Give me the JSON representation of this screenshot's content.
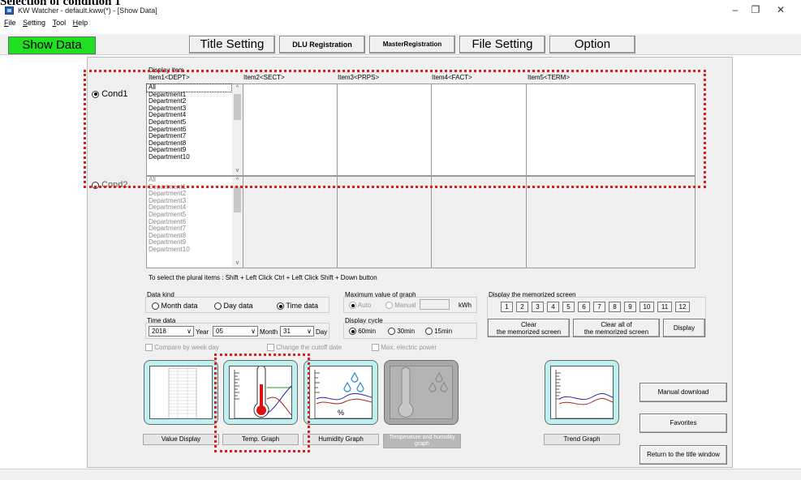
{
  "page_heading": "Selection of condition 1",
  "window": {
    "title": "KW Watcher - default.kww(*) - [Show Data]",
    "controls": [
      "–",
      "❐",
      "✕"
    ]
  },
  "menu": [
    "File",
    "Setting",
    "Tool",
    "Help"
  ],
  "top_tabs": {
    "show_data": "Show Data",
    "title_setting": "Title Setting",
    "dlu_registration": "DLU Registration",
    "master_registration": "MasterRegistration",
    "file_setting": "File Setting",
    "option": "Option"
  },
  "display_item_label": "Display item",
  "columns": [
    "Item1<DEPT>",
    "Item2<SECT>",
    "Item3<PRPS>",
    "Item4<FACT>",
    "Item5<TERM>"
  ],
  "cond1": {
    "label": "Cond1",
    "selected": true,
    "items": [
      "All",
      "Department1",
      "Department2",
      "Department3",
      "Department4",
      "Department5",
      "Department6",
      "Department7",
      "Department8",
      "Department9",
      "Department10"
    ]
  },
  "cond2": {
    "label": "Cond2",
    "selected": false,
    "items": [
      "All",
      "Department1",
      "Department2",
      "Department3",
      "Department4",
      "Department5",
      "Department6",
      "Department7",
      "Department8",
      "Department9",
      "Department10"
    ]
  },
  "hint": "To select the plural items : Shift + Left Click  Ctrl + Left Click  Shift + Down button",
  "data_kind": {
    "label": "Data kind",
    "options": [
      "Month data",
      "Day data",
      "Time data"
    ],
    "selected": "Time data"
  },
  "max_value": {
    "label": "Maximum value of graph",
    "options": [
      "Auto",
      "Manual"
    ],
    "selected": "Auto",
    "unit": "kWh"
  },
  "memorized": {
    "label": "Display the memorized screen",
    "slots": [
      "1",
      "2",
      "3",
      "4",
      "5",
      "6",
      "7",
      "8",
      "9",
      "10",
      "11",
      "12"
    ],
    "clear": "Clear\nthe memorized screen",
    "clear_all": "Clear all of\nthe memorized screen",
    "display": "Display"
  },
  "time_data": {
    "label": "Time data",
    "year": "2018",
    "year_label": "Year",
    "month": "05",
    "month_label": "Month",
    "day": "31",
    "day_label": "Day"
  },
  "display_cycle": {
    "label": "Display cycle",
    "options": [
      "60min",
      "30min",
      "15min"
    ],
    "selected": "60min"
  },
  "checkboxes": [
    "Compare by week day",
    "Change the cutoff date",
    "Max. electric power"
  ],
  "tiles": {
    "value_display": "Value Display",
    "temp_graph": "Temp. Graph",
    "humidity_graph": "Humidity Graph",
    "temp_humidity": "Temperature and humidity graph",
    "trend_graph": "Trend Graph"
  },
  "right_buttons": {
    "manual_download": "Manual download",
    "favorites": "Favorites",
    "return": "Return to the title window"
  },
  "colors": {
    "show_data_bg": "#21e021",
    "highlight": "#e21b1b",
    "tile_bg": "#bff0f0"
  }
}
